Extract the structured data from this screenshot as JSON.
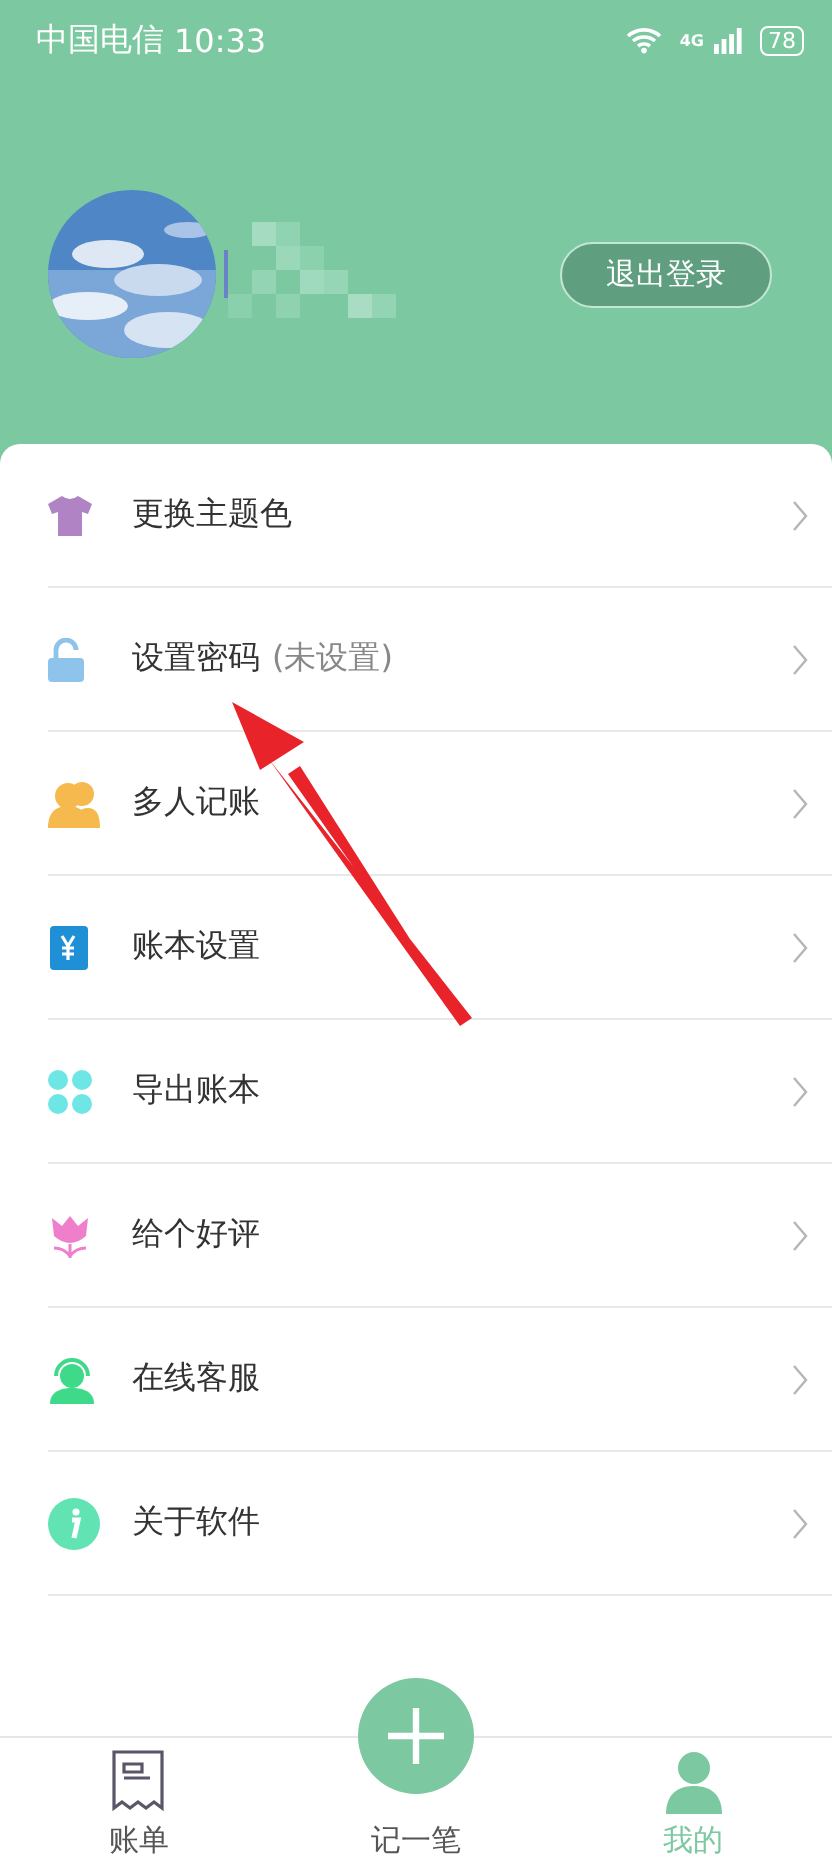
{
  "status_bar": {
    "carrier": "中国电信",
    "time": "10:33",
    "network": "4G",
    "battery": "78"
  },
  "profile": {
    "logout_button": "退出登录"
  },
  "menu": [
    {
      "label": "更换主题色",
      "kind": "shirt",
      "color": "#b083c4"
    },
    {
      "label": "设置密码",
      "note": "(未设置)",
      "kind": "lock",
      "color": "#8ec3ec"
    },
    {
      "label": "多人记账",
      "kind": "people",
      "color": "#f6b94e"
    },
    {
      "label": "账本设置",
      "kind": "book",
      "color": "#1f8fd6"
    },
    {
      "label": "导出账本",
      "kind": "clover",
      "color": "#6ee6e6"
    },
    {
      "label": "给个好评",
      "kind": "flower",
      "color": "#f07fcb"
    },
    {
      "label": "在线客服",
      "kind": "headset",
      "color": "#3fd98a"
    },
    {
      "label": "关于软件",
      "kind": "info",
      "color": "#62e3b4"
    }
  ],
  "tab_bar": [
    {
      "label": "账单",
      "kind": "bill",
      "selected": false
    },
    {
      "label": "记一笔",
      "kind": "plus",
      "selected": false
    },
    {
      "label": "我的",
      "kind": "person",
      "selected": true
    }
  ]
}
